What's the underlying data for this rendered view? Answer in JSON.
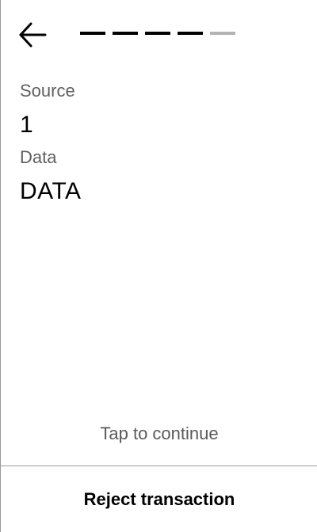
{
  "header": {
    "back_icon": "arrow-left-icon",
    "progress": {
      "total_steps": 5,
      "completed_steps": 4
    }
  },
  "fields": [
    {
      "label": "Source",
      "value": "1"
    },
    {
      "label": "Data",
      "value": "DATA"
    }
  ],
  "footer": {
    "tap_hint": "Tap to continue",
    "reject_label": "Reject transaction"
  },
  "colors": {
    "progress_done": "#000000",
    "progress_pending": "#b3b3b3",
    "label_gray": "#606060",
    "divider": "#9a9a9a"
  }
}
